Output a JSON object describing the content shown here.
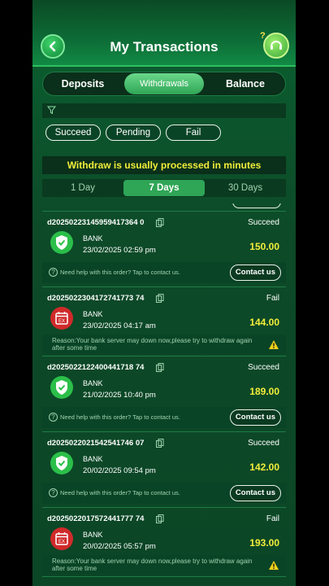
{
  "header": {
    "title": "My Transactions"
  },
  "tabs": [
    {
      "label": "Deposits",
      "active": false
    },
    {
      "label": "Withdrawals",
      "active": true
    },
    {
      "label": "Balance",
      "active": false
    }
  ],
  "status_filters": [
    "Succeed",
    "Pending",
    "Fail"
  ],
  "notice": "Withdraw is usually processed in minutes",
  "day_filters": [
    {
      "label": "1 Day",
      "active": false
    },
    {
      "label": "7 Days",
      "active": true
    },
    {
      "label": "30 Days",
      "active": false
    }
  ],
  "help_text": "Need help with this order? Tap to contact us.",
  "contact_label": "Contact us",
  "transactions": [
    {
      "order_id": "d20250223145959417364 0",
      "status": "Succeed",
      "method": "BANK",
      "date": "23/02/2025 02:59 pm",
      "amount": "150.00",
      "kind": "ok"
    },
    {
      "order_id": "d2025022304172741773 74",
      "status": "Fail",
      "method": "BANK",
      "date": "23/02/2025 04:17 am",
      "amount": "144.00",
      "kind": "fail",
      "reason": "Reason:Your bank server may down now,please try to withdraw again after some time"
    },
    {
      "order_id": "d2025022122400441718 74",
      "status": "Succeed",
      "method": "BANK",
      "date": "21/02/2025 10:40 pm",
      "amount": "189.00",
      "kind": "ok"
    },
    {
      "order_id": "d2025022021542541746 07",
      "status": "Succeed",
      "method": "BANK",
      "date": "20/02/2025 09:54 pm",
      "amount": "142.00",
      "kind": "ok"
    },
    {
      "order_id": "d2025022017572441777 74",
      "status": "Fail",
      "method": "BANK",
      "date": "20/02/2025 05:57 pm",
      "amount": "193.00",
      "kind": "fail",
      "reason": "Reason:Your bank server may down now,please try to withdraw again after some time"
    }
  ],
  "colors": {
    "accent_green": "#2fa556",
    "amount_yellow": "#f2ee3a",
    "fail_red": "#d02a2a",
    "ok_green": "#2bbf4a"
  }
}
